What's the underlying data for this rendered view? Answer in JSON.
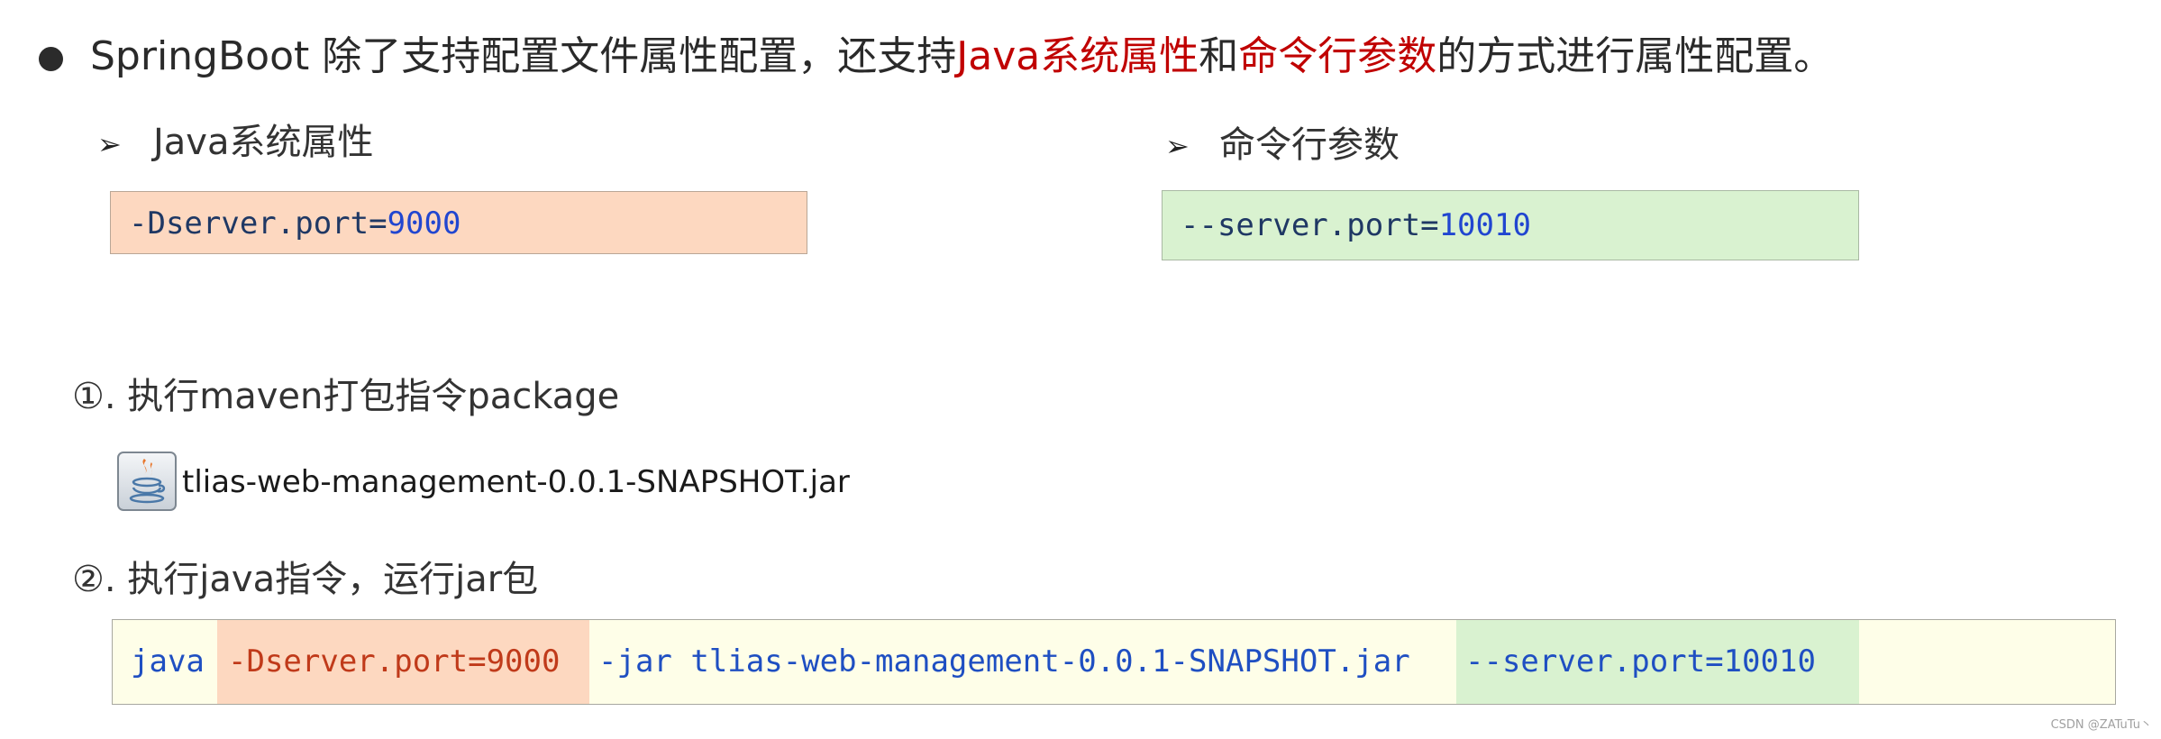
{
  "intro": {
    "prefix": "SpringBoot 除了支持配置文件属性配置，还支持",
    "highlight1": "Java系统属性",
    "connector": "和",
    "highlight2": "命令行参数",
    "suffix": "的方式进行属性配置。"
  },
  "java_props": {
    "title": "Java系统属性",
    "code_key": "-Dserver.port=",
    "code_value": "9000"
  },
  "cli_args": {
    "title": "命令行参数",
    "code_key": "--server.port=",
    "code_value": "10010"
  },
  "steps": {
    "step1": "①. 执行maven打包指令package",
    "jar_file": "tlias-web-management-0.0.1-SNAPSHOT.jar",
    "step2": "②. 执行java指令，运行jar包"
  },
  "command": {
    "java": "java",
    "system_prop": "-Dserver.port=9000",
    "jar_part": "-jar tlias-web-management-0.0.1-SNAPSHOT.jar",
    "cli_arg": "--server.port=10010"
  },
  "watermark": "CSDN @ZATuTu丶",
  "colors": {
    "highlight_red": "#c00000",
    "peach_box": "#fdd8c0",
    "green_box": "#d9f2d0",
    "command_bg": "#fefee8",
    "code_blue": "#1f4fc2"
  }
}
